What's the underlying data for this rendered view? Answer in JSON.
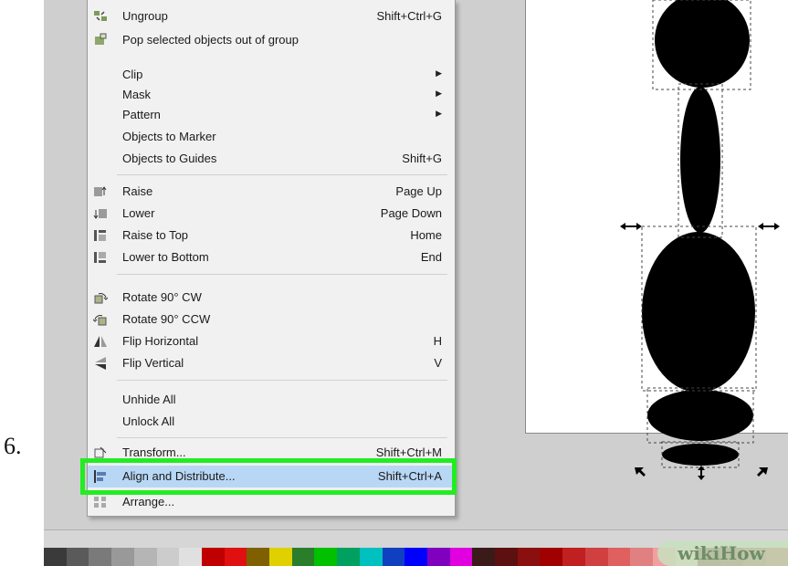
{
  "step_number": "6.",
  "menu": {
    "items": [
      {
        "label": "Ungroup",
        "shortcut": "Shift+Ctrl+G",
        "icon": "ungroup-icon"
      },
      {
        "label": "Pop selected objects out of group",
        "shortcut": "",
        "icon": "pop-out-icon"
      },
      {
        "label": "Clip",
        "shortcut": "",
        "submenu": true
      },
      {
        "label": "Mask",
        "shortcut": "",
        "submenu": true
      },
      {
        "label": "Pattern",
        "shortcut": "",
        "submenu": true
      },
      {
        "label": "Objects to Marker",
        "shortcut": ""
      },
      {
        "label": "Objects to Guides",
        "shortcut": "Shift+G"
      },
      {
        "label": "Raise",
        "shortcut": "Page Up",
        "icon": "raise-icon"
      },
      {
        "label": "Lower",
        "shortcut": "Page Down",
        "icon": "lower-icon"
      },
      {
        "label": "Raise to Top",
        "shortcut": "Home",
        "icon": "raise-to-top-icon"
      },
      {
        "label": "Lower to Bottom",
        "shortcut": "End",
        "icon": "lower-to-bottom-icon"
      },
      {
        "label": "Rotate 90° CW",
        "shortcut": "",
        "icon": "rotate-cw-icon"
      },
      {
        "label": "Rotate 90° CCW",
        "shortcut": "",
        "icon": "rotate-ccw-icon"
      },
      {
        "label": "Flip Horizontal",
        "shortcut": "H",
        "icon": "flip-horizontal-icon"
      },
      {
        "label": "Flip Vertical",
        "shortcut": "V",
        "icon": "flip-vertical-icon"
      },
      {
        "label": "Unhide All",
        "shortcut": ""
      },
      {
        "label": "Unlock All",
        "shortcut": ""
      },
      {
        "label": "Transform...",
        "shortcut": "Shift+Ctrl+M",
        "icon": "transform-icon"
      },
      {
        "label": "Align and Distribute...",
        "shortcut": "Shift+Ctrl+A",
        "icon": "align-distribute-icon",
        "highlighted": true
      },
      {
        "label": "Arrange...",
        "shortcut": "",
        "icon": "arrange-icon"
      }
    ]
  },
  "colors": {
    "highlight_box": "#22ec22",
    "menu_highlight": "#b8d7f5",
    "palette": [
      "#3a3a3a",
      "#5a5a5a",
      "#7a7a7a",
      "#999999",
      "#b5b5b5",
      "#cccccc",
      "#e0e0e0",
      "#c00000",
      "#e01010",
      "#7f6000",
      "#e0d000",
      "#2a7d2a",
      "#00c000",
      "#00a060",
      "#00c0c0",
      "#1040c0",
      "#0000ff",
      "#8000c0",
      "#e000e0",
      "#3b1a1a",
      "#5c1010",
      "#8a1010",
      "#a00000",
      "#c02020",
      "#d04040",
      "#e06060",
      "#e08080",
      "#f0a0a0",
      "#f5c0c0",
      "#5c0000",
      "#7a1a1a",
      "#9a3030",
      "#c04040"
    ]
  },
  "watermark": {
    "text": "wikiHow"
  }
}
